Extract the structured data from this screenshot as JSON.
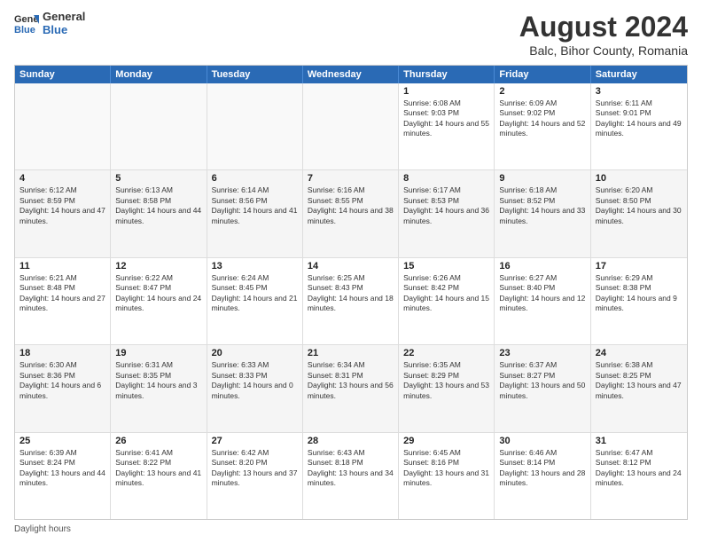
{
  "header": {
    "logo_general": "General",
    "logo_blue": "Blue",
    "title": "August 2024",
    "subtitle": "Balc, Bihor County, Romania"
  },
  "days_of_week": [
    "Sunday",
    "Monday",
    "Tuesday",
    "Wednesday",
    "Thursday",
    "Friday",
    "Saturday"
  ],
  "rows": [
    [
      {
        "day": "",
        "empty": true
      },
      {
        "day": "",
        "empty": true
      },
      {
        "day": "",
        "empty": true
      },
      {
        "day": "",
        "empty": true
      },
      {
        "day": "1",
        "sunrise": "6:08 AM",
        "sunset": "9:03 PM",
        "daylight": "14 hours and 55 minutes."
      },
      {
        "day": "2",
        "sunrise": "6:09 AM",
        "sunset": "9:02 PM",
        "daylight": "14 hours and 52 minutes."
      },
      {
        "day": "3",
        "sunrise": "6:11 AM",
        "sunset": "9:01 PM",
        "daylight": "14 hours and 49 minutes."
      }
    ],
    [
      {
        "day": "4",
        "sunrise": "6:12 AM",
        "sunset": "8:59 PM",
        "daylight": "14 hours and 47 minutes."
      },
      {
        "day": "5",
        "sunrise": "6:13 AM",
        "sunset": "8:58 PM",
        "daylight": "14 hours and 44 minutes."
      },
      {
        "day": "6",
        "sunrise": "6:14 AM",
        "sunset": "8:56 PM",
        "daylight": "14 hours and 41 minutes."
      },
      {
        "day": "7",
        "sunrise": "6:16 AM",
        "sunset": "8:55 PM",
        "daylight": "14 hours and 38 minutes."
      },
      {
        "day": "8",
        "sunrise": "6:17 AM",
        "sunset": "8:53 PM",
        "daylight": "14 hours and 36 minutes."
      },
      {
        "day": "9",
        "sunrise": "6:18 AM",
        "sunset": "8:52 PM",
        "daylight": "14 hours and 33 minutes."
      },
      {
        "day": "10",
        "sunrise": "6:20 AM",
        "sunset": "8:50 PM",
        "daylight": "14 hours and 30 minutes."
      }
    ],
    [
      {
        "day": "11",
        "sunrise": "6:21 AM",
        "sunset": "8:48 PM",
        "daylight": "14 hours and 27 minutes."
      },
      {
        "day": "12",
        "sunrise": "6:22 AM",
        "sunset": "8:47 PM",
        "daylight": "14 hours and 24 minutes."
      },
      {
        "day": "13",
        "sunrise": "6:24 AM",
        "sunset": "8:45 PM",
        "daylight": "14 hours and 21 minutes."
      },
      {
        "day": "14",
        "sunrise": "6:25 AM",
        "sunset": "8:43 PM",
        "daylight": "14 hours and 18 minutes."
      },
      {
        "day": "15",
        "sunrise": "6:26 AM",
        "sunset": "8:42 PM",
        "daylight": "14 hours and 15 minutes."
      },
      {
        "day": "16",
        "sunrise": "6:27 AM",
        "sunset": "8:40 PM",
        "daylight": "14 hours and 12 minutes."
      },
      {
        "day": "17",
        "sunrise": "6:29 AM",
        "sunset": "8:38 PM",
        "daylight": "14 hours and 9 minutes."
      }
    ],
    [
      {
        "day": "18",
        "sunrise": "6:30 AM",
        "sunset": "8:36 PM",
        "daylight": "14 hours and 6 minutes."
      },
      {
        "day": "19",
        "sunrise": "6:31 AM",
        "sunset": "8:35 PM",
        "daylight": "14 hours and 3 minutes."
      },
      {
        "day": "20",
        "sunrise": "6:33 AM",
        "sunset": "8:33 PM",
        "daylight": "14 hours and 0 minutes."
      },
      {
        "day": "21",
        "sunrise": "6:34 AM",
        "sunset": "8:31 PM",
        "daylight": "13 hours and 56 minutes."
      },
      {
        "day": "22",
        "sunrise": "6:35 AM",
        "sunset": "8:29 PM",
        "daylight": "13 hours and 53 minutes."
      },
      {
        "day": "23",
        "sunrise": "6:37 AM",
        "sunset": "8:27 PM",
        "daylight": "13 hours and 50 minutes."
      },
      {
        "day": "24",
        "sunrise": "6:38 AM",
        "sunset": "8:25 PM",
        "daylight": "13 hours and 47 minutes."
      }
    ],
    [
      {
        "day": "25",
        "sunrise": "6:39 AM",
        "sunset": "8:24 PM",
        "daylight": "13 hours and 44 minutes."
      },
      {
        "day": "26",
        "sunrise": "6:41 AM",
        "sunset": "8:22 PM",
        "daylight": "13 hours and 41 minutes."
      },
      {
        "day": "27",
        "sunrise": "6:42 AM",
        "sunset": "8:20 PM",
        "daylight": "13 hours and 37 minutes."
      },
      {
        "day": "28",
        "sunrise": "6:43 AM",
        "sunset": "8:18 PM",
        "daylight": "13 hours and 34 minutes."
      },
      {
        "day": "29",
        "sunrise": "6:45 AM",
        "sunset": "8:16 PM",
        "daylight": "13 hours and 31 minutes."
      },
      {
        "day": "30",
        "sunrise": "6:46 AM",
        "sunset": "8:14 PM",
        "daylight": "13 hours and 28 minutes."
      },
      {
        "day": "31",
        "sunrise": "6:47 AM",
        "sunset": "8:12 PM",
        "daylight": "13 hours and 24 minutes."
      }
    ]
  ],
  "footer": {
    "note": "Daylight hours"
  }
}
